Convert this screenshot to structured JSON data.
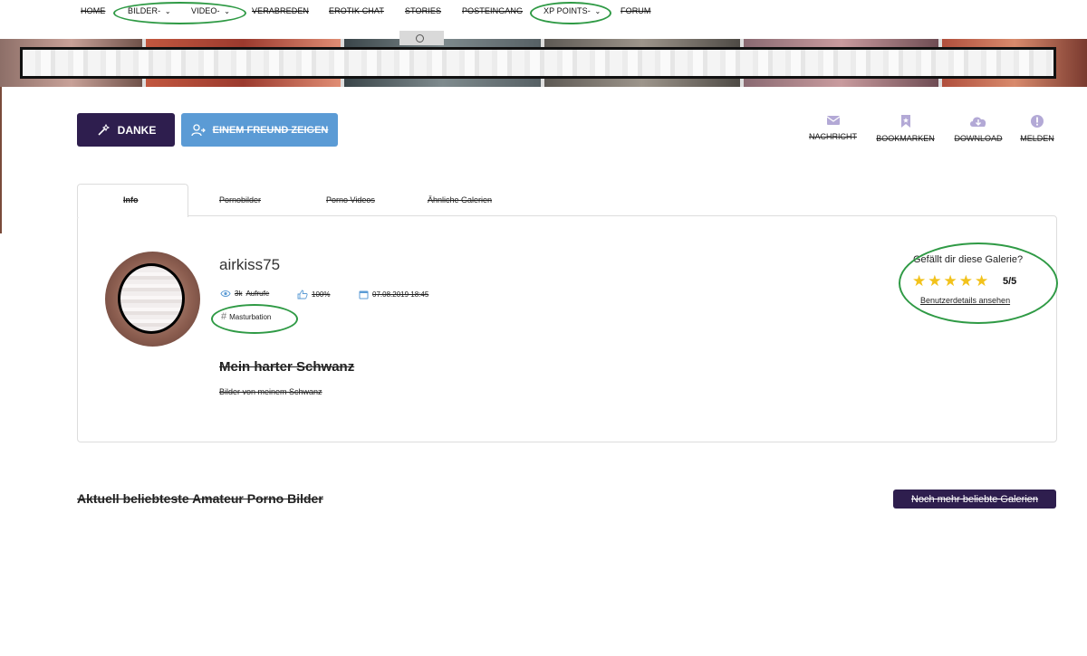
{
  "nav": {
    "items": [
      {
        "label": "HOME"
      },
      {
        "label": "BILDER"
      },
      {
        "label": "VIDEO"
      },
      {
        "label": "VERABREDEN"
      },
      {
        "label": "EROTIK CHAT"
      },
      {
        "label": "STORIES"
      },
      {
        "label": "POSTEINGANG"
      },
      {
        "label": "XP POINTS"
      },
      {
        "label": "FORUM"
      }
    ]
  },
  "actions": {
    "thanks_label": "DANKE",
    "share_label": "EINEM FREUND ZEIGEN",
    "message_label": "NACHRICHT",
    "bookmark_label": "BOOKMARKEN",
    "download_label": "DOWNLOAD",
    "report_label": "MELDEN"
  },
  "tabs": [
    {
      "label": "Info"
    },
    {
      "label": "Pornobilder"
    },
    {
      "label": "Porno Videos"
    },
    {
      "label": "Ähnliche Galerien"
    }
  ],
  "profile": {
    "username": "airkiss75",
    "views_count": "3k",
    "views_label": "Aufrufe",
    "likes": "100%",
    "date": "07.08.2019 18:45",
    "tag": "Masturbation"
  },
  "gallery": {
    "title": "Mein harter Schwanz",
    "description": "Bilder von meinem Schwanz"
  },
  "rating": {
    "question": "Gefällt dir diese Galerie?",
    "value": "5/5",
    "stars": 5,
    "link_label": "Benutzerdetails ansehen"
  },
  "section": {
    "title": "Aktuell beliebteste Amateur Porno Bilder",
    "more_button": "Noch mehr beliebte Galerien"
  },
  "colors": {
    "accent_dark": "#2e1e4e",
    "accent_blue": "#5b9bd5",
    "icon_lavender": "#b3a9d6",
    "star": "#f2c21b",
    "highlight_green": "#2f9a45"
  }
}
